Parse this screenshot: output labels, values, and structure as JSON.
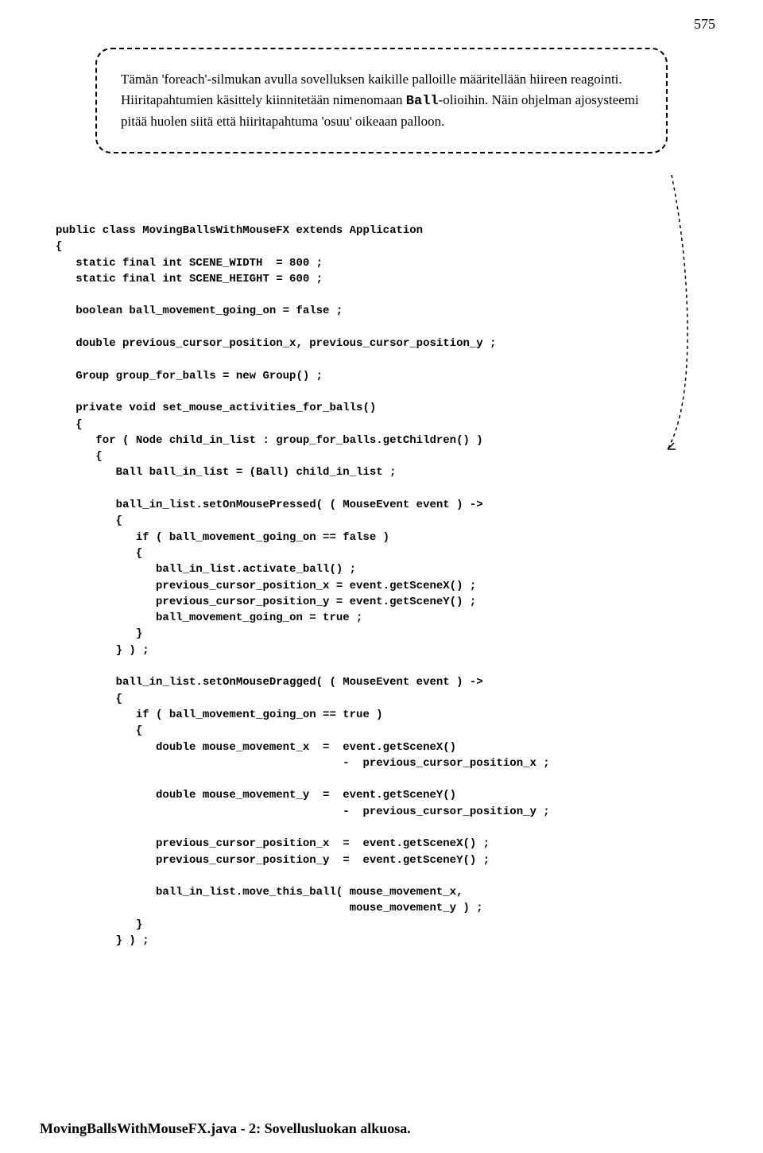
{
  "page_number": "575",
  "callout": {
    "line1a": "Tämän 'foreach'-silmukan avulla sovelluksen kaikille palloille määritellään hiireen reagointi. Hiiritapahtumien käsittely kiinnitetään nimenomaan ",
    "line1_mono": "Ball",
    "line1b": "-olioihin. Näin ohjelman ajosysteemi pitää huolen siitä että hiiritapahtuma 'osuu' oikeaan palloon."
  },
  "code": "public class MovingBallsWithMouseFX extends Application\n{\n   static final int SCENE_WIDTH  = 800 ;\n   static final int SCENE_HEIGHT = 600 ;\n\n   boolean ball_movement_going_on = false ;\n\n   double previous_cursor_position_x, previous_cursor_position_y ;\n\n   Group group_for_balls = new Group() ;\n\n   private void set_mouse_activities_for_balls()\n   {\n      for ( Node child_in_list : group_for_balls.getChildren() )\n      {\n         Ball ball_in_list = (Ball) child_in_list ;\n\n         ball_in_list.setOnMousePressed( ( MouseEvent event ) ->\n         {\n            if ( ball_movement_going_on == false )\n            {\n               ball_in_list.activate_ball() ;\n               previous_cursor_position_x = event.getSceneX() ;\n               previous_cursor_position_y = event.getSceneY() ;\n               ball_movement_going_on = true ;\n            }\n         } ) ;\n\n         ball_in_list.setOnMouseDragged( ( MouseEvent event ) ->\n         {\n            if ( ball_movement_going_on == true )\n            {\n               double mouse_movement_x  =  event.getSceneX()\n                                           -  previous_cursor_position_x ;\n\n               double mouse_movement_y  =  event.getSceneY()\n                                           -  previous_cursor_position_y ;\n\n               previous_cursor_position_x  =  event.getSceneX() ;\n               previous_cursor_position_y  =  event.getSceneY() ;\n\n               ball_in_list.move_this_ball( mouse_movement_x,\n                                            mouse_movement_y ) ;\n            }\n         } ) ;",
  "caption": "MovingBallsWithMouseFX.java - 2:  Sovellusluokan alkuosa."
}
